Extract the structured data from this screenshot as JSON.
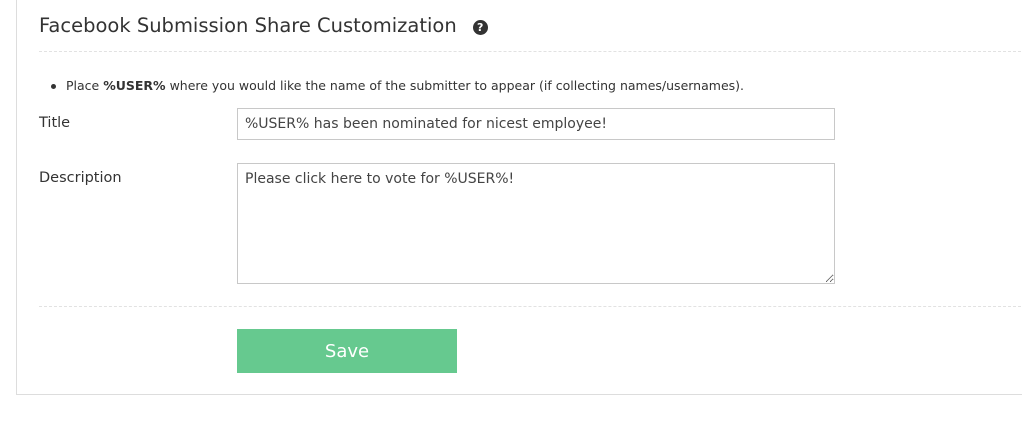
{
  "section": {
    "heading": "Facebook Submission Share Customization",
    "help_icon": "question-circle-icon",
    "help_glyph": "?"
  },
  "instructions": {
    "prefix": "Place ",
    "token": "%USER%",
    "suffix": " where you would like the name of the submitter to appear (if collecting names/usernames)."
  },
  "form": {
    "title_label": "Title",
    "title_value": "%USER% has been nominated for nicest employee!",
    "description_label": "Description",
    "description_value": "Please click here to vote for %USER%!",
    "save_label": "Save"
  },
  "colors": {
    "save_button": "#66c98f",
    "text": "#333333",
    "border": "#c8c8c8"
  }
}
